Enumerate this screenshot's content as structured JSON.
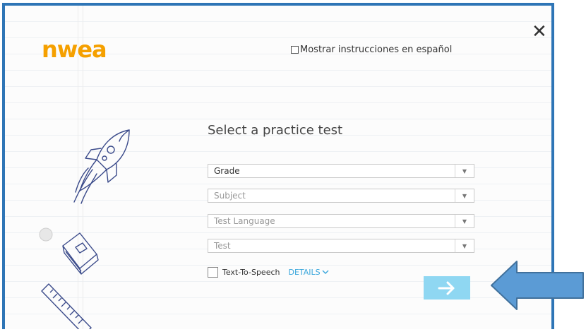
{
  "header": {
    "logo_text": "nwea",
    "spanish_toggle_label": "Mostrar instrucciones en español",
    "close_glyph": "✕"
  },
  "main": {
    "title": "Select a practice test",
    "selects": [
      {
        "value": "Grade",
        "enabled": true
      },
      {
        "value": "Subject",
        "enabled": false
      },
      {
        "value": "Test Language",
        "enabled": false
      },
      {
        "value": "Test",
        "enabled": false
      }
    ],
    "tts_label": "Text-To-Speech",
    "details_label": "DETAILS"
  },
  "colors": {
    "frame": "#2e75b6",
    "logo": "#f5a000",
    "next_button": "#8fd7f2",
    "details_link": "#3ba7dc",
    "annotation_arrow": "#5b9bd5"
  },
  "icons": {
    "close": "close-icon",
    "caret": "caret-down-icon",
    "details": "chevron-down-icon",
    "next": "arrow-right-icon",
    "doodles": [
      "rocket-doodle",
      "book-doodle",
      "ruler-doodle",
      "hole-punch"
    ]
  }
}
